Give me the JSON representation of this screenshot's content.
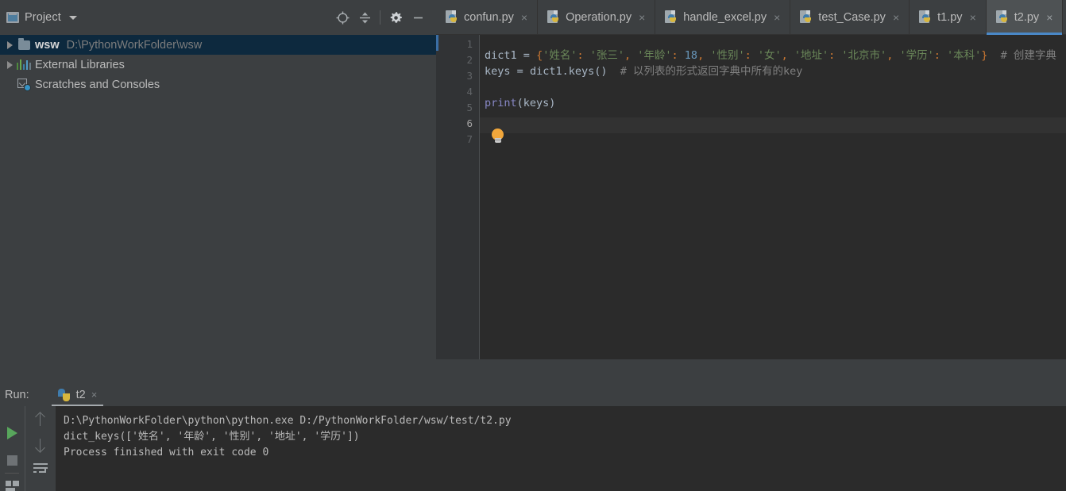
{
  "project_panel": {
    "title": "Project",
    "dropdown_icon": "chevron-down-icon",
    "toolbar": [
      {
        "name": "locate-icon",
        "label": "Select Opened File"
      },
      {
        "name": "collapse-all-icon",
        "label": "Collapse All"
      },
      {
        "name": "gear-icon",
        "label": "Settings"
      },
      {
        "name": "minimize-icon",
        "label": "Hide"
      }
    ],
    "tree": [
      {
        "label": "wsw",
        "sub": "D:\\PythonWorkFolder\\wsw",
        "icon": "folder-icon",
        "expander": "collapsed-arrow",
        "selected": true
      },
      {
        "label": "External Libraries",
        "sub": "",
        "icon": "libraries-bars-icon",
        "expander": "collapsed-arrow",
        "selected": false
      },
      {
        "label": "Scratches and Consoles",
        "sub": "",
        "icon": "scratches-icon",
        "expander": "none",
        "selected": false
      }
    ]
  },
  "tabs": [
    {
      "label": "confun.py",
      "icon": "python-file-icon",
      "active": false,
      "close": "×"
    },
    {
      "label": "Operation.py",
      "icon": "python-file-icon",
      "active": false,
      "close": "×"
    },
    {
      "label": "handle_excel.py",
      "icon": "python-file-icon",
      "active": false,
      "close": "×"
    },
    {
      "label": "test_Case.py",
      "icon": "python-file-icon",
      "active": false,
      "close": "×"
    },
    {
      "label": "t1.py",
      "icon": "python-file-icon",
      "active": false,
      "close": "×"
    },
    {
      "label": "t2.py",
      "icon": "python-file-icon",
      "active": true,
      "close": "×"
    },
    {
      "label": "",
      "icon": "python-file-icon",
      "active": false,
      "close": ""
    }
  ],
  "editor": {
    "line_numbers": [
      "1",
      "2",
      "3",
      "4",
      "5",
      "6",
      "7"
    ],
    "current_line": 6,
    "intention_icon": "lightbulb-icon",
    "lines": {
      "l2_code": "dict1 = {'姓名': '张三', '年龄': 18, '性别': '女', '地址': '北京市', '学历': '本科'}",
      "l2_comment": "# 创建字典",
      "l3_code": "keys = dict1.keys()",
      "l3_comment": "# 以列表的形式返回字典中所有的key",
      "l5_code": "print(keys)"
    },
    "tokens": {
      "var_dict1": "dict1",
      "eq": "=",
      "brace_open": "{",
      "brace_close": "}",
      "k_name": "'姓名'",
      "v_name": "'张三'",
      "k_age": "'年龄'",
      "v_age": "18",
      "k_sex": "'性别'",
      "v_sex": "'女'",
      "k_addr": "'地址'",
      "v_addr": "'北京市'",
      "k_edu": "'学历'",
      "v_edu": "'本科'",
      "var_keys": "keys",
      "call_keys": "dict1.keys()",
      "fn_print": "print",
      "arg_keys": "(keys)"
    }
  },
  "run_panel": {
    "label": "Run:",
    "tab_name": "t2",
    "tab_icon": "python-logo-icon",
    "tab_close": "×",
    "controls": [
      {
        "name": "run-button",
        "icon": "play-icon"
      },
      {
        "name": "stop-button",
        "icon": "stop-icon"
      },
      {
        "name": "layout-button",
        "icon": "layout-icon"
      },
      {
        "name": "prev-occurrence",
        "icon": "arrow-up-icon"
      },
      {
        "name": "next-occurrence",
        "icon": "arrow-down-icon"
      },
      {
        "name": "soft-wrap-toggle",
        "icon": "soft-wrap-icon"
      }
    ],
    "console": [
      "D:\\PythonWorkFolder\\python\\python.exe D:/PythonWorkFolder/wsw/test/t2.py",
      "dict_keys(['姓名', '年龄', '性别', '地址', '学历'])",
      "",
      "Process finished with exit code 0"
    ]
  },
  "colors": {
    "chrome": "#3c3f41",
    "editor_bg": "#2b2b2b",
    "gutter_bg": "#313335",
    "selection": "#0d293e",
    "accent_blue": "#4a88c7",
    "string_green": "#6a8759",
    "number_blue": "#6897bb",
    "punct_orange": "#cc7832",
    "comment_gray": "#808080",
    "identifier": "#a9b7c6",
    "run_green": "#58a65c"
  }
}
